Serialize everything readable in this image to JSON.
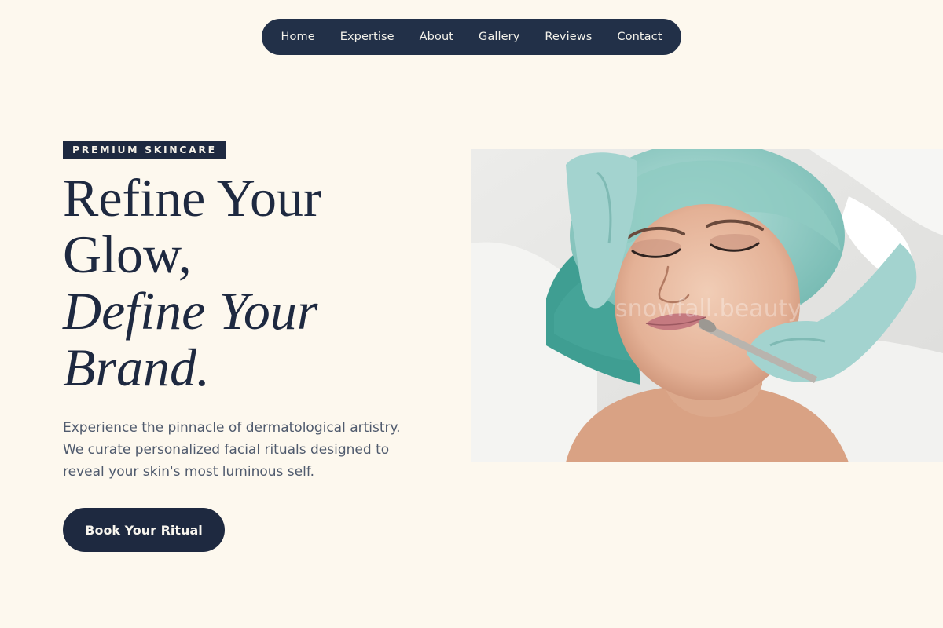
{
  "nav": {
    "items": [
      {
        "label": "Home"
      },
      {
        "label": "Expertise"
      },
      {
        "label": "About"
      },
      {
        "label": "Gallery"
      },
      {
        "label": "Reviews"
      },
      {
        "label": "Contact"
      }
    ]
  },
  "hero": {
    "badge": "PREMIUM SKINCARE",
    "headline": {
      "line1": "Refine Your",
      "line2": "Glow,",
      "line3": "Define Your",
      "line4": "Brand."
    },
    "subtext": "Experience the pinnacle of dermatological artistry. We curate personalized facial rituals designed to reveal your skin's most luminous self.",
    "cta_label": "Book Your Ritual",
    "image": {
      "watermark": "snowfall.beauty"
    }
  },
  "colors": {
    "background": "#fdf8ee",
    "navy": "#1e2940",
    "nav_pill": "#223048",
    "body_text": "#4f5a6d",
    "glove_teal": "#a3d3cf",
    "towel_teal": "#3f9e92"
  },
  "icons": []
}
